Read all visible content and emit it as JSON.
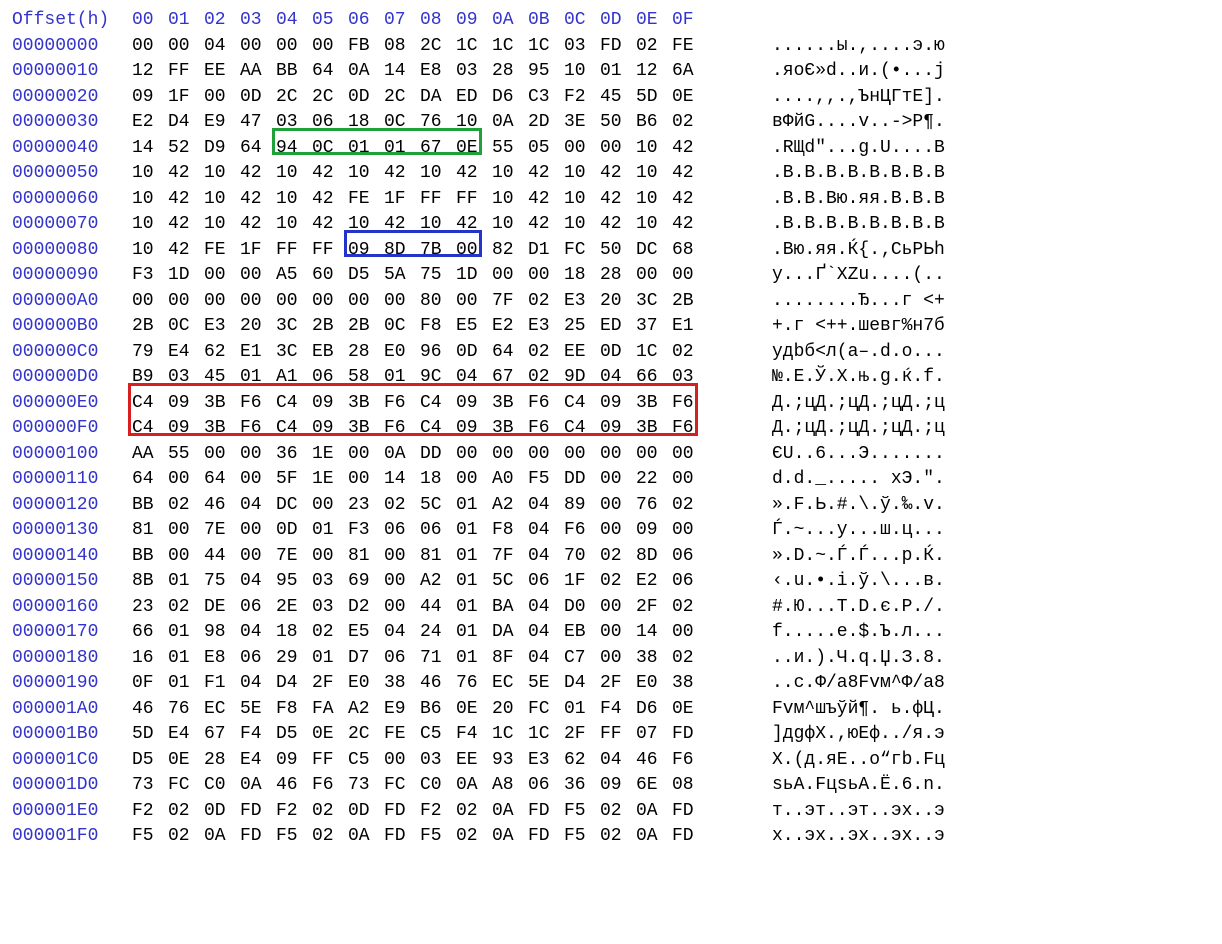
{
  "header": {
    "label": "Offset(h)",
    "cols": [
      "00",
      "01",
      "02",
      "03",
      "04",
      "05",
      "06",
      "07",
      "08",
      "09",
      "0A",
      "0B",
      "0C",
      "0D",
      "0E",
      "0F"
    ]
  },
  "rows": [
    {
      "addr": "00000000",
      "hex": [
        "00",
        "00",
        "04",
        "00",
        "00",
        "00",
        "FB",
        "08",
        "2C",
        "1C",
        "1C",
        "1C",
        "03",
        "FD",
        "02",
        "FE"
      ],
      "ascii": "......ы.,....э.ю"
    },
    {
      "addr": "00000010",
      "hex": [
        "12",
        "FF",
        "EE",
        "AA",
        "BB",
        "64",
        "0A",
        "14",
        "E8",
        "03",
        "28",
        "95",
        "10",
        "01",
        "12",
        "6A"
      ],
      "ascii": ".яоЄ»d..и.(•...j"
    },
    {
      "addr": "00000020",
      "hex": [
        "09",
        "1F",
        "00",
        "0D",
        "2C",
        "2C",
        "0D",
        "2C",
        "DA",
        "ED",
        "D6",
        "C3",
        "F2",
        "45",
        "5D",
        "0E"
      ],
      "ascii": "....,,.,ЪнЦГтE]."
    },
    {
      "addr": "00000030",
      "hex": [
        "E2",
        "D4",
        "E9",
        "47",
        "03",
        "06",
        "18",
        "0C",
        "76",
        "10",
        "0A",
        "2D",
        "3E",
        "50",
        "B6",
        "02"
      ],
      "ascii": "вФйG....v..->P¶."
    },
    {
      "addr": "00000040",
      "hex": [
        "14",
        "52",
        "D9",
        "64",
        "94",
        "0C",
        "01",
        "01",
        "67",
        "0E",
        "55",
        "05",
        "00",
        "00",
        "10",
        "42"
      ],
      "ascii": ".RЩd\"...g.U....B"
    },
    {
      "addr": "00000050",
      "hex": [
        "10",
        "42",
        "10",
        "42",
        "10",
        "42",
        "10",
        "42",
        "10",
        "42",
        "10",
        "42",
        "10",
        "42",
        "10",
        "42"
      ],
      "ascii": ".B.B.B.B.B.B.B.B"
    },
    {
      "addr": "00000060",
      "hex": [
        "10",
        "42",
        "10",
        "42",
        "10",
        "42",
        "FE",
        "1F",
        "FF",
        "FF",
        "10",
        "42",
        "10",
        "42",
        "10",
        "42"
      ],
      "ascii": ".B.B.Bю.яя.B.B.B"
    },
    {
      "addr": "00000070",
      "hex": [
        "10",
        "42",
        "10",
        "42",
        "10",
        "42",
        "10",
        "42",
        "10",
        "42",
        "10",
        "42",
        "10",
        "42",
        "10",
        "42"
      ],
      "ascii": ".B.B.B.B.B.B.B.B"
    },
    {
      "addr": "00000080",
      "hex": [
        "10",
        "42",
        "FE",
        "1F",
        "FF",
        "FF",
        "09",
        "8D",
        "7B",
        "00",
        "82",
        "D1",
        "FC",
        "50",
        "DC",
        "68"
      ],
      "ascii": ".Bю.яя.Ќ{.‚СьPЬh"
    },
    {
      "addr": "00000090",
      "hex": [
        "F3",
        "1D",
        "00",
        "00",
        "A5",
        "60",
        "D5",
        "5A",
        "75",
        "1D",
        "00",
        "00",
        "18",
        "28",
        "00",
        "00"
      ],
      "ascii": "у...Ґ`ХZu....(.."
    },
    {
      "addr": "000000A0",
      "hex": [
        "00",
        "00",
        "00",
        "00",
        "00",
        "00",
        "00",
        "00",
        "80",
        "00",
        "7F",
        "02",
        "E3",
        "20",
        "3C",
        "2B"
      ],
      "ascii": "........Ђ...г <+"
    },
    {
      "addr": "000000B0",
      "hex": [
        "2B",
        "0C",
        "E3",
        "20",
        "3C",
        "2B",
        "2B",
        "0C",
        "F8",
        "E5",
        "E2",
        "E3",
        "25",
        "ED",
        "37",
        "E1"
      ],
      "ascii": "+.г <++.шевг%н7б"
    },
    {
      "addr": "000000C0",
      "hex": [
        "79",
        "E4",
        "62",
        "E1",
        "3C",
        "EB",
        "28",
        "E0",
        "96",
        "0D",
        "64",
        "02",
        "EE",
        "0D",
        "1C",
        "02"
      ],
      "ascii": "yдbб<л(а–.d.о..."
    },
    {
      "addr": "000000D0",
      "hex": [
        "B9",
        "03",
        "45",
        "01",
        "A1",
        "06",
        "58",
        "01",
        "9C",
        "04",
        "67",
        "02",
        "9D",
        "04",
        "66",
        "03"
      ],
      "ascii": "№.E.Ў.X.њ.g.ќ.f."
    },
    {
      "addr": "000000E0",
      "hex": [
        "C4",
        "09",
        "3B",
        "F6",
        "C4",
        "09",
        "3B",
        "F6",
        "C4",
        "09",
        "3B",
        "F6",
        "C4",
        "09",
        "3B",
        "F6"
      ],
      "ascii": "Д.;цД.;цД.;цД.;ц"
    },
    {
      "addr": "000000F0",
      "hex": [
        "C4",
        "09",
        "3B",
        "F6",
        "C4",
        "09",
        "3B",
        "F6",
        "C4",
        "09",
        "3B",
        "F6",
        "C4",
        "09",
        "3B",
        "F6"
      ],
      "ascii": "Д.;цД.;цД.;цД.;ц"
    },
    {
      "addr": "00000100",
      "hex": [
        "AA",
        "55",
        "00",
        "00",
        "36",
        "1E",
        "00",
        "0A",
        "DD",
        "00",
        "00",
        "00",
        "00",
        "00",
        "00",
        "00"
      ],
      "ascii": "ЄU..6...Э......."
    },
    {
      "addr": "00000110",
      "hex": [
        "64",
        "00",
        "64",
        "00",
        "5F",
        "1E",
        "00",
        "14",
        "18",
        "00",
        "A0",
        "F5",
        "DD",
        "00",
        "22",
        "00"
      ],
      "ascii": "d.d._..... хЭ.\"."
    },
    {
      "addr": "00000120",
      "hex": [
        "BB",
        "02",
        "46",
        "04",
        "DC",
        "00",
        "23",
        "02",
        "5C",
        "01",
        "A2",
        "04",
        "89",
        "00",
        "76",
        "02"
      ],
      "ascii": "».F.Ь.#.\\.ў.‰.v."
    },
    {
      "addr": "00000130",
      "hex": [
        "81",
        "00",
        "7E",
        "00",
        "0D",
        "01",
        "F3",
        "06",
        "06",
        "01",
        "F8",
        "04",
        "F6",
        "00",
        "09",
        "00"
      ],
      "ascii": "Ѓ.~...у...ш.ц..."
    },
    {
      "addr": "00000140",
      "hex": [
        "BB",
        "00",
        "44",
        "00",
        "7E",
        "00",
        "81",
        "00",
        "81",
        "01",
        "7F",
        "04",
        "70",
        "02",
        "8D",
        "06"
      ],
      "ascii": "».D.~.Ѓ.Ѓ...p.Ќ."
    },
    {
      "addr": "00000150",
      "hex": [
        "8B",
        "01",
        "75",
        "04",
        "95",
        "03",
        "69",
        "00",
        "A2",
        "01",
        "5C",
        "06",
        "1F",
        "02",
        "E2",
        "06"
      ],
      "ascii": "‹.u.•.i.ў.\\...в."
    },
    {
      "addr": "00000160",
      "hex": [
        "23",
        "02",
        "DE",
        "06",
        "2E",
        "03",
        "D2",
        "00",
        "44",
        "01",
        "BA",
        "04",
        "D0",
        "00",
        "2F",
        "02"
      ],
      "ascii": "#.Ю...Т.D.є.Р./."
    },
    {
      "addr": "00000170",
      "hex": [
        "66",
        "01",
        "98",
        "04",
        "18",
        "02",
        "E5",
        "04",
        "24",
        "01",
        "DA",
        "04",
        "EB",
        "00",
        "14",
        "00"
      ],
      "ascii": "f.....е.$.Ъ.л..."
    },
    {
      "addr": "00000180",
      "hex": [
        "16",
        "01",
        "E8",
        "06",
        "29",
        "01",
        "D7",
        "06",
        "71",
        "01",
        "8F",
        "04",
        "C7",
        "00",
        "38",
        "02"
      ],
      "ascii": "..и.).Ч.q.Џ.З.8."
    },
    {
      "addr": "00000190",
      "hex": [
        "0F",
        "01",
        "F1",
        "04",
        "D4",
        "2F",
        "E0",
        "38",
        "46",
        "76",
        "EC",
        "5E",
        "D4",
        "2F",
        "E0",
        "38"
      ],
      "ascii": "..с.Ф/а8Fvм^Ф/а8"
    },
    {
      "addr": "000001A0",
      "hex": [
        "46",
        "76",
        "EC",
        "5E",
        "F8",
        "FA",
        "A2",
        "E9",
        "B6",
        "0E",
        "20",
        "FC",
        "01",
        "F4",
        "D6",
        "0E"
      ],
      "ascii": "Fvм^шъўй¶. ь.фЦ."
    },
    {
      "addr": "000001B0",
      "hex": [
        "5D",
        "E4",
        "67",
        "F4",
        "D5",
        "0E",
        "2C",
        "FE",
        "C5",
        "F4",
        "1C",
        "1C",
        "2F",
        "FF",
        "07",
        "FD"
      ],
      "ascii": "]дgфХ.,юЕф../я.э"
    },
    {
      "addr": "000001C0",
      "hex": [
        "D5",
        "0E",
        "28",
        "E4",
        "09",
        "FF",
        "C5",
        "00",
        "03",
        "EE",
        "93",
        "E3",
        "62",
        "04",
        "46",
        "F6"
      ],
      "ascii": "Х.(д.яЕ..о“гb.Fц"
    },
    {
      "addr": "000001D0",
      "hex": [
        "73",
        "FC",
        "C0",
        "0A",
        "46",
        "F6",
        "73",
        "FC",
        "C0",
        "0A",
        "A8",
        "06",
        "36",
        "09",
        "6E",
        "08"
      ],
      "ascii": "sьА.FцsьА.Ё.6.n."
    },
    {
      "addr": "000001E0",
      "hex": [
        "F2",
        "02",
        "0D",
        "FD",
        "F2",
        "02",
        "0D",
        "FD",
        "F2",
        "02",
        "0A",
        "FD",
        "F5",
        "02",
        "0A",
        "FD"
      ],
      "ascii": "т..эт..эт..эх..э"
    },
    {
      "addr": "000001F0",
      "hex": [
        "F5",
        "02",
        "0A",
        "FD",
        "F5",
        "02",
        "0A",
        "FD",
        "F5",
        "02",
        "0A",
        "FD",
        "F5",
        "02",
        "0A",
        "FD"
      ],
      "ascii": "х..эх..эх..эх..э"
    }
  ],
  "highlights": [
    {
      "class": "box-green",
      "row": 4,
      "colStart": 4,
      "colEnd": 9
    },
    {
      "class": "box-blue",
      "row": 8,
      "colStart": 6,
      "colEnd": 9
    },
    {
      "class": "box-red",
      "row": 14,
      "colStart": 0,
      "colEnd": 15,
      "rowspan": 2
    }
  ]
}
